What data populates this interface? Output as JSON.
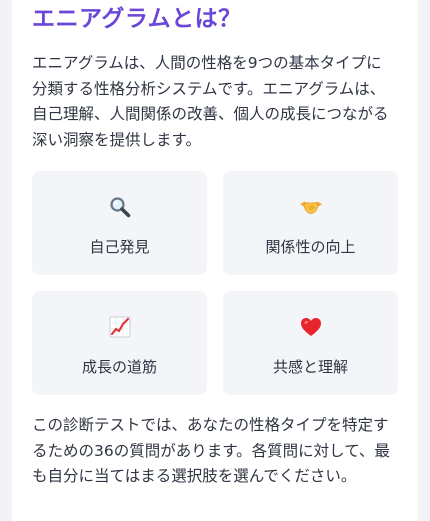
{
  "section": {
    "title": "エニアグラムとは？",
    "intro": "エニアグラムは、人間の性格を9つの基本タイプに分類する性格分析システムです。エニアグラムは、自己理解、人間関係の改善、個人の成長につながる深い洞察を提供します。",
    "features": [
      {
        "icon": "magnifier-icon",
        "label": "自己発見"
      },
      {
        "icon": "handshake-icon",
        "label": "関係性の向上"
      },
      {
        "icon": "chart-increasing-icon",
        "label": "成長の道筋"
      },
      {
        "icon": "red-heart-icon",
        "label": "共感と理解"
      }
    ],
    "outro": "この診断テストでは、あなたの性格タイプを特定するための36の質問があります。各質問に対して、最も自分に当てはまる選択肢を選んでください。"
  },
  "colors": {
    "title": "#6a47d8",
    "text": "#2f3542",
    "tile_background": "#f3f5f8",
    "page_background": "#f1f3f6"
  }
}
